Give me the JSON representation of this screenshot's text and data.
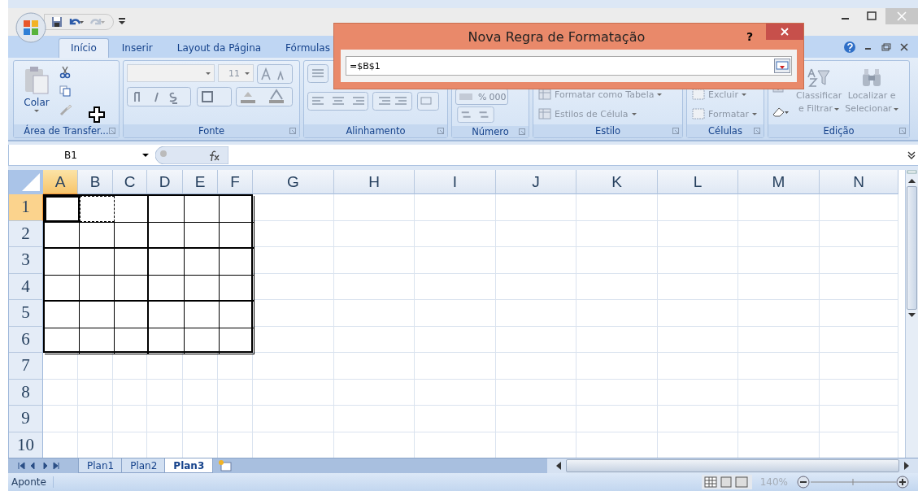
{
  "quick_access": {
    "redo_disabled": true
  },
  "ribbon_tabs": [
    {
      "label": "Início",
      "selected": true
    },
    {
      "label": "Inserir",
      "selected": false
    },
    {
      "label": "Layout da Página",
      "selected": false
    },
    {
      "label": "Fórmulas",
      "selected": false
    }
  ],
  "groups": {
    "clipboard": {
      "label": "Área de Transfer...",
      "paste": "Colar"
    },
    "font": {
      "label": "Fonte",
      "size": "11"
    },
    "alignment": {
      "label": "Alinhamento"
    },
    "number": {
      "label": "Número",
      "percent": "%",
      "thousands": "000"
    },
    "styles": {
      "label": "Estilo",
      "buttons": [
        "Formatar como Tabela",
        "Estilos de Célula"
      ]
    },
    "cells": {
      "label": "Células",
      "buttons": [
        "Excluir",
        "Formatar"
      ]
    },
    "editing": {
      "label": "Edição",
      "buttons": [
        {
          "lines": [
            "Classificar",
            "e Filtrar"
          ]
        },
        {
          "lines": [
            "Localizar e",
            "Selecionar"
          ]
        }
      ]
    }
  },
  "name_box": "B1",
  "columns": [
    {
      "label": "A",
      "selected": true
    },
    {
      "label": "B",
      "selected": false
    },
    {
      "label": "C",
      "selected": false
    },
    {
      "label": "D",
      "selected": false
    },
    {
      "label": "E",
      "selected": false
    },
    {
      "label": "F",
      "selected": false
    },
    {
      "label": "G",
      "selected": false
    },
    {
      "label": "H",
      "selected": false
    },
    {
      "label": "I",
      "selected": false
    },
    {
      "label": "J",
      "selected": false
    },
    {
      "label": "K",
      "selected": false
    },
    {
      "label": "L",
      "selected": false
    },
    {
      "label": "M",
      "selected": false
    },
    {
      "label": "N",
      "selected": false
    }
  ],
  "rows": [
    {
      "label": "1",
      "selected": true
    },
    {
      "label": "2",
      "selected": false
    },
    {
      "label": "3",
      "selected": false
    },
    {
      "label": "4",
      "selected": false
    },
    {
      "label": "5",
      "selected": false
    },
    {
      "label": "6",
      "selected": false
    },
    {
      "label": "7",
      "selected": false
    },
    {
      "label": "8",
      "selected": false
    },
    {
      "label": "9",
      "selected": false
    },
    {
      "label": "10",
      "selected": false
    }
  ],
  "sheets": [
    {
      "label": "Plan1",
      "selected": false
    },
    {
      "label": "Plan2",
      "selected": false
    },
    {
      "label": "Plan3",
      "selected": true
    }
  ],
  "status_bar": {
    "mode": "Aponte",
    "zoom": "140%"
  },
  "dialog": {
    "title": "Nova Regra de Formatação",
    "help": "?",
    "value": "=$B$1"
  }
}
